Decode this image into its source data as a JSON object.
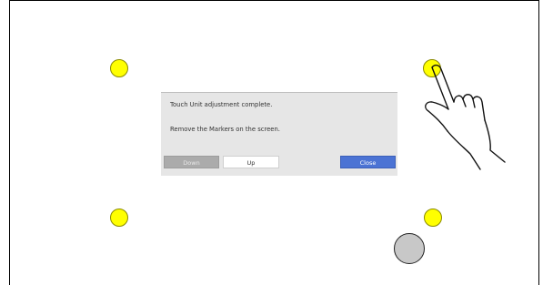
{
  "markers": [
    {
      "position": "top-left",
      "icon": "touch-calibration-marker",
      "color": "#ffff00"
    },
    {
      "position": "top-right",
      "icon": "touch-calibration-marker",
      "color": "#ffff00"
    },
    {
      "position": "bottom-left",
      "icon": "touch-calibration-marker",
      "color": "#ffff00"
    },
    {
      "position": "bottom-right",
      "icon": "touch-calibration-marker",
      "color": "#ffff00"
    }
  ],
  "dialog": {
    "message": "Touch Unit adjustment complete.",
    "instruction": "Remove the Markers on the screen.",
    "buttons": {
      "down": "Down",
      "up": "Up",
      "close": "Close"
    },
    "colors": {
      "background": "#e6e6e6",
      "close_button": "#4b73d4",
      "down_button_disabled": "#ababab"
    }
  },
  "icons": {
    "hand": "pointing-hand-icon",
    "round_button": "round-gray-button-icon"
  }
}
